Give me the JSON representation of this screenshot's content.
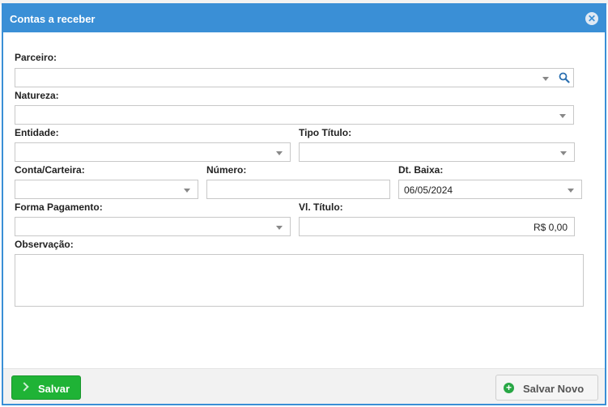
{
  "dialog": {
    "title": "Contas a receber",
    "close_icon": "close-icon"
  },
  "form": {
    "parceiro": {
      "label": "Parceiro:",
      "value": ""
    },
    "natureza": {
      "label": "Natureza:",
      "value": ""
    },
    "entidade": {
      "label": "Entidade:",
      "value": ""
    },
    "tipo_titulo": {
      "label": "Tipo Título:",
      "value": ""
    },
    "conta_carteira": {
      "label": "Conta/Carteira:",
      "value": ""
    },
    "numero": {
      "label": "Número:",
      "value": ""
    },
    "dt_baixa": {
      "label": "Dt. Baixa:",
      "value": "06/05/2024"
    },
    "forma_pagamento": {
      "label": "Forma Pagamento:",
      "value": ""
    },
    "vl_titulo": {
      "label": "Vl. Título:",
      "value": "R$ 0,00"
    },
    "observacao": {
      "label": "Observação:",
      "value": ""
    }
  },
  "footer": {
    "save_label": "Salvar",
    "save_new_label": "Salvar Novo"
  },
  "colors": {
    "titlebar": "#3a8fd6",
    "save_button": "#1fb336",
    "save_new_icon": "#28a745"
  }
}
